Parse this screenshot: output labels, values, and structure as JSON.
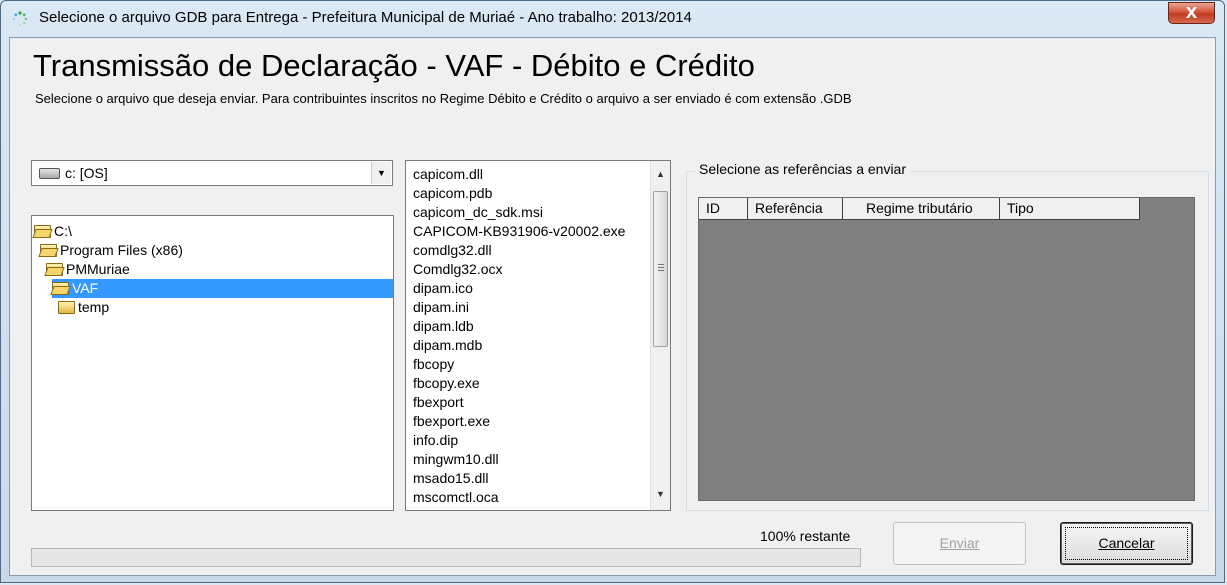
{
  "window": {
    "title": "Selecione o arquivo GDB para Entrega  - Prefeitura Municipal de Muriaé - Ano trabalho: 2013/2014",
    "close_label": "X",
    "icon": "loading-spinner-icon"
  },
  "header": {
    "heading": "Transmissão de Declaração - VAF - Débito e Crédito",
    "subtitle": "Selecione o arquivo que deseja enviar. Para contribuintes inscritos no Regime Débito e Crédito o arquivo a ser enviado é com extensão .GDB"
  },
  "drive": {
    "selected": "c: [OS]",
    "icon": "drive-icon"
  },
  "directories": [
    {
      "label": "C:\\",
      "level": 0,
      "selected": false
    },
    {
      "label": "Program Files (x86)",
      "level": 1,
      "selected": false
    },
    {
      "label": "PMMuriae",
      "level": 2,
      "selected": false
    },
    {
      "label": "VAF",
      "level": 3,
      "selected": true
    },
    {
      "label": "temp",
      "level": 4,
      "selected": false
    }
  ],
  "files": [
    "capicom.dll",
    "capicom.pdb",
    "capicom_dc_sdk.msi",
    "CAPICOM-KB931906-v20002.exe",
    "comdlg32.dll",
    "Comdlg32.ocx",
    "dipam.ico",
    "dipam.ini",
    "dipam.ldb",
    "dipam.mdb",
    "fbcopy",
    "fbcopy.exe",
    "fbexport",
    "fbexport.exe",
    "info.dip",
    "mingwm10.dll",
    "msado15.dll",
    "mscomctl.oca"
  ],
  "references": {
    "group_label": "Selecione as referências a enviar",
    "columns": [
      "ID",
      "Referência",
      "Regime tributário",
      "Tipo"
    ],
    "rows": []
  },
  "status": {
    "text": "100% restante",
    "progress_percent": 0
  },
  "buttons": {
    "send": "Enviar",
    "cancel": "Cancelar"
  },
  "colors": {
    "selection": "#3399ff",
    "grid_background": "#808080",
    "close_button": "#c9452b"
  }
}
